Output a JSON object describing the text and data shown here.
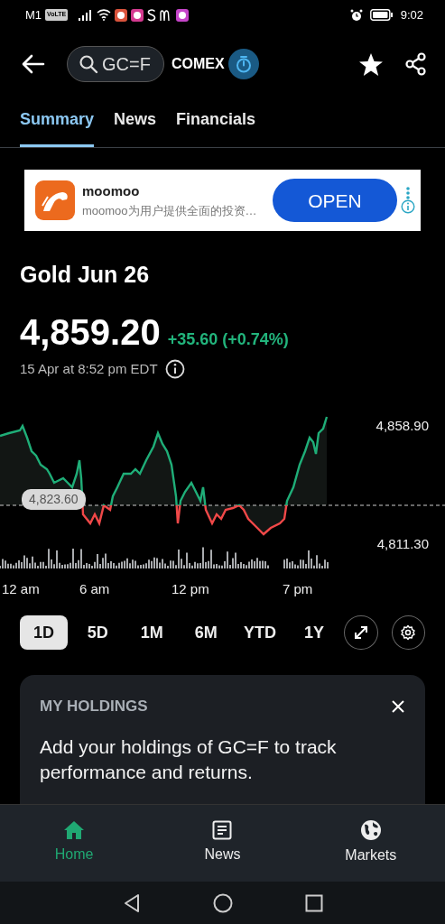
{
  "status_bar": {
    "carrier": "M1",
    "network_badge": "VoLTE",
    "time": "9:02"
  },
  "header": {
    "search": "GC=F",
    "exchange": "COMEX"
  },
  "tabs": [
    {
      "label": "Summary",
      "selected": true
    },
    {
      "label": "News",
      "selected": false
    },
    {
      "label": "Financials",
      "selected": false
    }
  ],
  "ad": {
    "title": "moomoo",
    "text": "moomoo为用户提供全面的投资…",
    "button": "OPEN"
  },
  "quote": {
    "name": "Gold Jun 26",
    "price": "4,859.20",
    "change": "+35.60 (+0.74%)",
    "time": "15 Apr at 8:52 pm EDT"
  },
  "chart": {
    "high_label": "4,858.90",
    "low_label": "4,811.30",
    "reference_label": "4,823.60",
    "x_labels": [
      "12 am",
      "6 am",
      "12 pm",
      "7 pm"
    ]
  },
  "ranges": [
    {
      "label": "1D",
      "selected": true
    },
    {
      "label": "5D",
      "selected": false
    },
    {
      "label": "1M",
      "selected": false
    },
    {
      "label": "6M",
      "selected": false
    },
    {
      "label": "YTD",
      "selected": false
    },
    {
      "label": "1Y",
      "selected": false
    }
  ],
  "holdings": {
    "title": "MY HOLDINGS",
    "text": "Add your holdings of GC=F to track performance and returns."
  },
  "bottom_nav": [
    {
      "label": "Home",
      "selected": true
    },
    {
      "label": "News",
      "selected": false
    },
    {
      "label": "Markets",
      "selected": false
    }
  ]
}
